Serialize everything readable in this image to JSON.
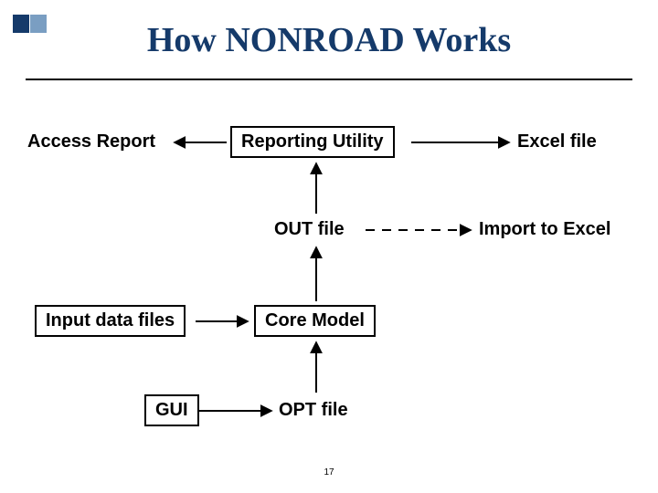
{
  "title": "How NONROAD Works",
  "nodes": {
    "access_report": "Access Report",
    "reporting_utility": "Reporting Utility",
    "excel_file": "Excel file",
    "out_file": "OUT file",
    "import_to_excel": "Import to Excel",
    "input_data_files": "Input data files",
    "core_model": "Core Model",
    "gui": "GUI",
    "opt_file": "OPT file"
  },
  "page_number": "17"
}
